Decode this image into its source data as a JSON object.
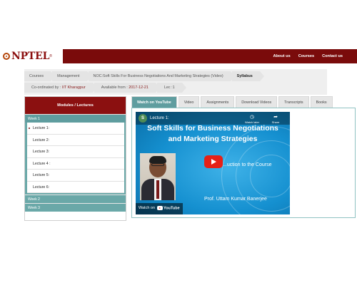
{
  "header": {
    "logo_text": "NPTEL",
    "logo_reg": "®",
    "nav": [
      "About us",
      "Courses",
      "Contact us"
    ]
  },
  "breadcrumb": {
    "items": [
      "Courses",
      "Management",
      "NOC:Soft Skills For Business Negotiations And Marketing Strategies (Video)",
      "Syllabus"
    ],
    "coordinated_label": "Co-ordinated by :",
    "coordinated_value": "IIT Kharagpur",
    "available_label": "Available from :",
    "available_value": "2017-12-21",
    "lec_label": "Lec :",
    "lec_value": "1"
  },
  "sidebar": {
    "heading": "Modules / Lectures",
    "weeks": [
      "Week 1",
      "Week 2",
      "Week 3"
    ],
    "lectures": [
      "Lecture 1:",
      "Lecture 2:",
      "Lecture 3:",
      "Lecture 4 :",
      "Lecture 5:",
      "Lecture 6:"
    ]
  },
  "tabs": [
    "Watch on YouTube",
    "Video",
    "Assignments",
    "Download Videos",
    "Transcripts",
    "Books"
  ],
  "video": {
    "channel_letter": "S",
    "title": "Lecture 1:",
    "watch_later": "Watch later",
    "share": "Share",
    "heading_line1": "Soft Skills for Business Negotiations",
    "heading_line2": "and Marketing Strategies",
    "intro_text": "...uction to the Course",
    "professor": "Prof. Uttam Kumar Banerjee",
    "watch_on": "Watch on",
    "youtube": "YouTube"
  },
  "colors": {
    "brand": "#7a0b0b",
    "teal": "#5f9d9f",
    "play": "#e62117"
  }
}
